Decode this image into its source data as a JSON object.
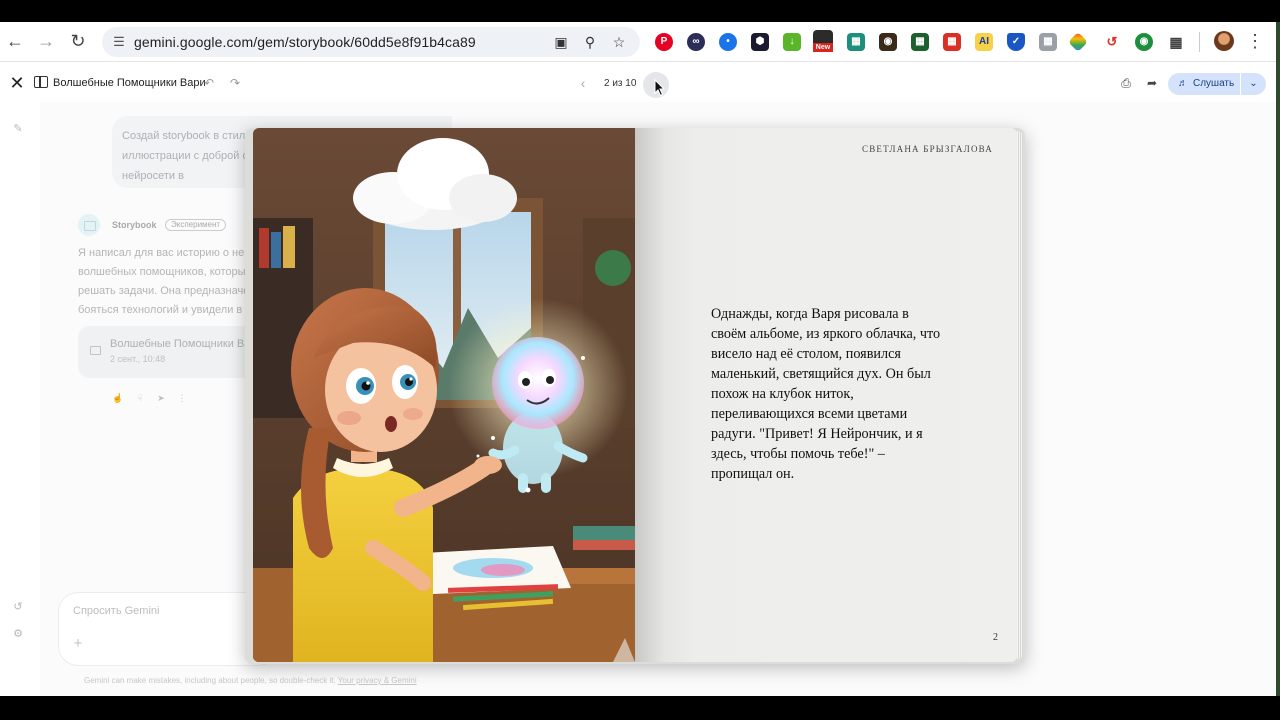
{
  "browser": {
    "url": "gemini.google.com/gem/storybook/60dd5e8f91b4ca89",
    "extension_new_badge": "New",
    "extension_ai_label": "AI"
  },
  "header": {
    "story_title": "Волшебные Помощники Вари",
    "page_counter": "2 из 10",
    "listen_label": "Слушать"
  },
  "chat": {
    "prompt_text": "Создай storybook в стиле иллюстрации с доброй с Представь нейросети в",
    "assistant_name": "Storybook",
    "badge": "Эксперимент",
    "reply_text": "Я написал для вас историю о ней волшебных помощников, которые решать задачи. Она предназначе бояться технологий и увидели в н",
    "card_title": "Волшебные Помощники Ва",
    "card_date": "2 сент., 10:48",
    "input_placeholder": "Спросить Gemini",
    "disclaimer": "Gemini can make mistakes, including about people, so double-check it.",
    "disclaimer_link": "Your privacy & Gemini"
  },
  "book": {
    "author": "СВЕТЛАНА БРЫЗГАЛОВА",
    "page_text": "Однажды, когда Варя рисовала в своём альбоме, из яркого облачка, что висело над её столом, появился маленький, светящийся дух. Он был похож на клубок ниток, переливающихся всеми цветами радуги. \"Привет! Я Нейрончик, и я здесь, чтобы помочь тебе!\" – пропищал он.",
    "page_number": "2"
  },
  "colors": {
    "accent": "#d4e3fb",
    "accent_text": "#1a3f85"
  }
}
